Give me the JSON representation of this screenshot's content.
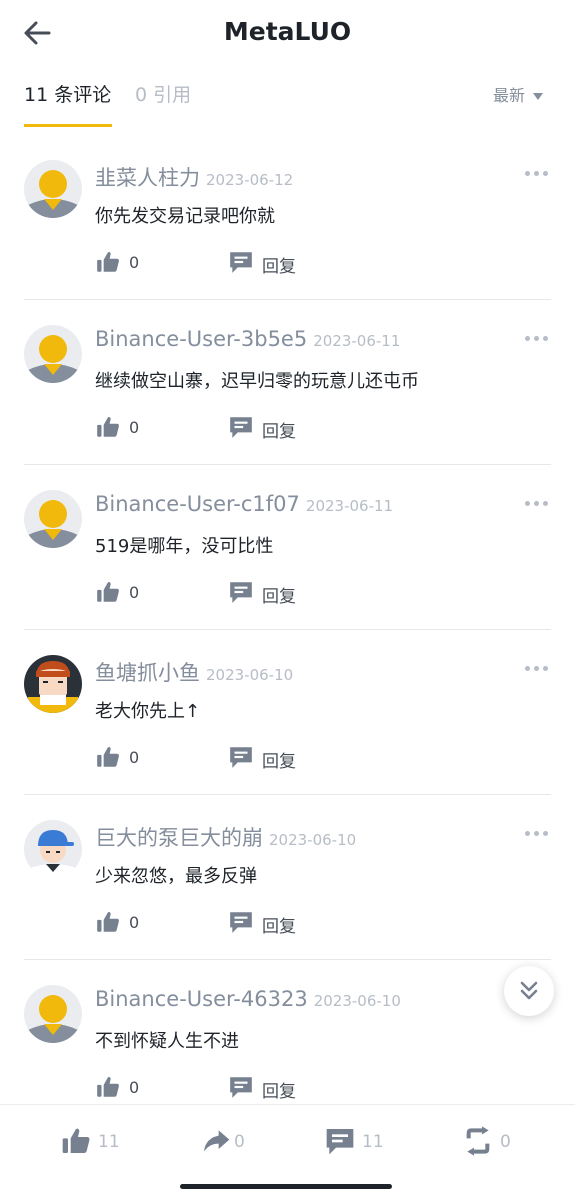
{
  "header": {
    "title": "MetaLUO"
  },
  "tabs": {
    "comments_label": "11 条评论",
    "quotes_label": "0 引用"
  },
  "sort": {
    "label": "最新"
  },
  "colors": {
    "accent": "#f0b90b",
    "text_primary": "#1e2329",
    "text_secondary": "#848e9c",
    "text_muted": "#b7bdc6",
    "icon_gray": "#76808f"
  },
  "comments": [
    {
      "username": "韭菜人柱力",
      "date": "2023-06-12",
      "text": "你先发交易记录吧你就",
      "likes": "0",
      "reply_label": "回复",
      "avatar": "default-avatar"
    },
    {
      "username": "Binance-User-3b5e5",
      "date": "2023-06-11",
      "text": "继续做空山寨，迟早归零的玩意儿还屯币",
      "likes": "0",
      "reply_label": "回复",
      "avatar": "default-avatar"
    },
    {
      "username": "Binance-User-c1f07",
      "date": "2023-06-11",
      "text": "519是哪年，没可比性",
      "likes": "0",
      "reply_label": "回复",
      "avatar": "default-avatar"
    },
    {
      "username": "鱼塘抓小鱼",
      "date": "2023-06-10",
      "text": "老大你先上↑",
      "likes": "0",
      "reply_label": "回复",
      "avatar": "dark-avatar"
    },
    {
      "username": "巨大的泵巨大的崩",
      "date": "2023-06-10",
      "text": "少来忽悠，最多反弹",
      "likes": "0",
      "reply_label": "回复",
      "avatar": "cap-avatar"
    },
    {
      "username": "Binance-User-46323",
      "date": "2023-06-10",
      "text": "不到怀疑人生不进",
      "likes": "0",
      "reply_label": "回复",
      "avatar": "default-avatar"
    }
  ],
  "bottom_bar": {
    "likes": "11",
    "shares": "0",
    "comments": "11",
    "reposts": "0"
  }
}
